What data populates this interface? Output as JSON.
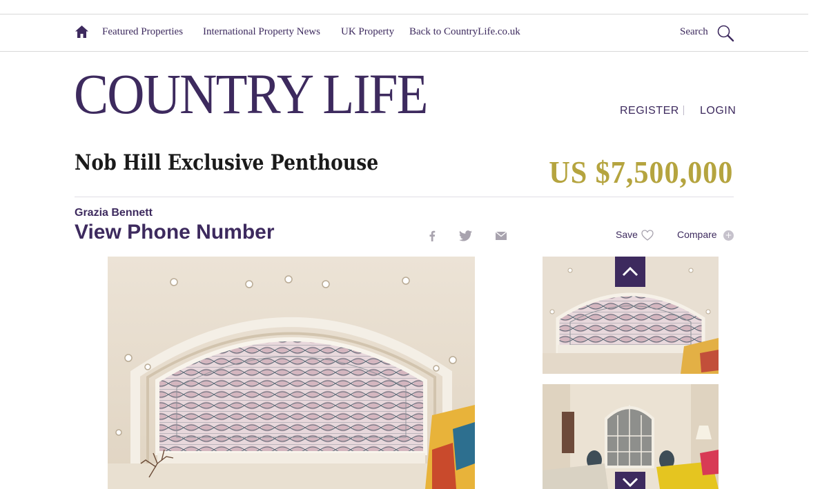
{
  "nav": {
    "links": [
      "Featured Properties",
      "International Property News",
      "UK Property",
      "Back to CountryLife.co.uk"
    ],
    "search_label": "Search",
    "home_icon": "home-icon",
    "search_icon": "magnifier-icon"
  },
  "header": {
    "logo": "COUNTRY LIFE",
    "register": "REGISTER",
    "login": "LOGIN"
  },
  "listing": {
    "title": "Nob Hill Exclusive Penthouse",
    "price": "US $7,500,000",
    "agent": "Grazia Bennett",
    "phone_cta": "View Phone Number",
    "share_icons": [
      "facebook-icon",
      "twitter-icon",
      "email-icon"
    ],
    "save_label": "Save",
    "compare_label": "Compare"
  },
  "colors": {
    "brand": "#3d2a5e",
    "price": "#b5a43f",
    "divider": "#d8d8d8"
  }
}
